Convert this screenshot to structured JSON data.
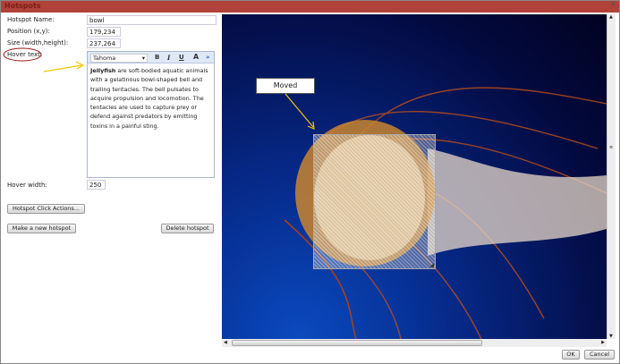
{
  "window": {
    "title": "Hotspots",
    "close": "✕"
  },
  "form": {
    "name_label": "Hotspot Name:",
    "name_value": "bowl",
    "position_label": "Position (x,y):",
    "position_value": "179,234",
    "size_label": "Size (width,height):",
    "size_value": "237,264",
    "hover_text_label": "Hover text:",
    "editor": {
      "font": "Tahoma",
      "bold": "B",
      "italic": "I",
      "underline": "U",
      "font_size": "A",
      "more": "»",
      "bold_word": "Jellyfish",
      "text": " are soft-bodied aquatic animals with a gelatinous bowl-shaped bell and trailing tentacles. The bell pulsates to acquire propulsion and locomotion. The tentacles are used to capture prey or defend against predators by emitting toxins in a painful sting."
    },
    "hover_width_label": "Hover width:",
    "hover_width_value": "250",
    "click_actions_button": "Hotspot Click Actions...",
    "new_button": "Make a new hotspot",
    "delete_button": "Delete hotspot"
  },
  "canvas": {
    "callout": "Moved"
  },
  "footer": {
    "ok": "OK",
    "cancel": "Cancel"
  },
  "colors": {
    "titlebar": "#b0423a",
    "annotation": "#f5c400",
    "circle": "#a01818"
  }
}
